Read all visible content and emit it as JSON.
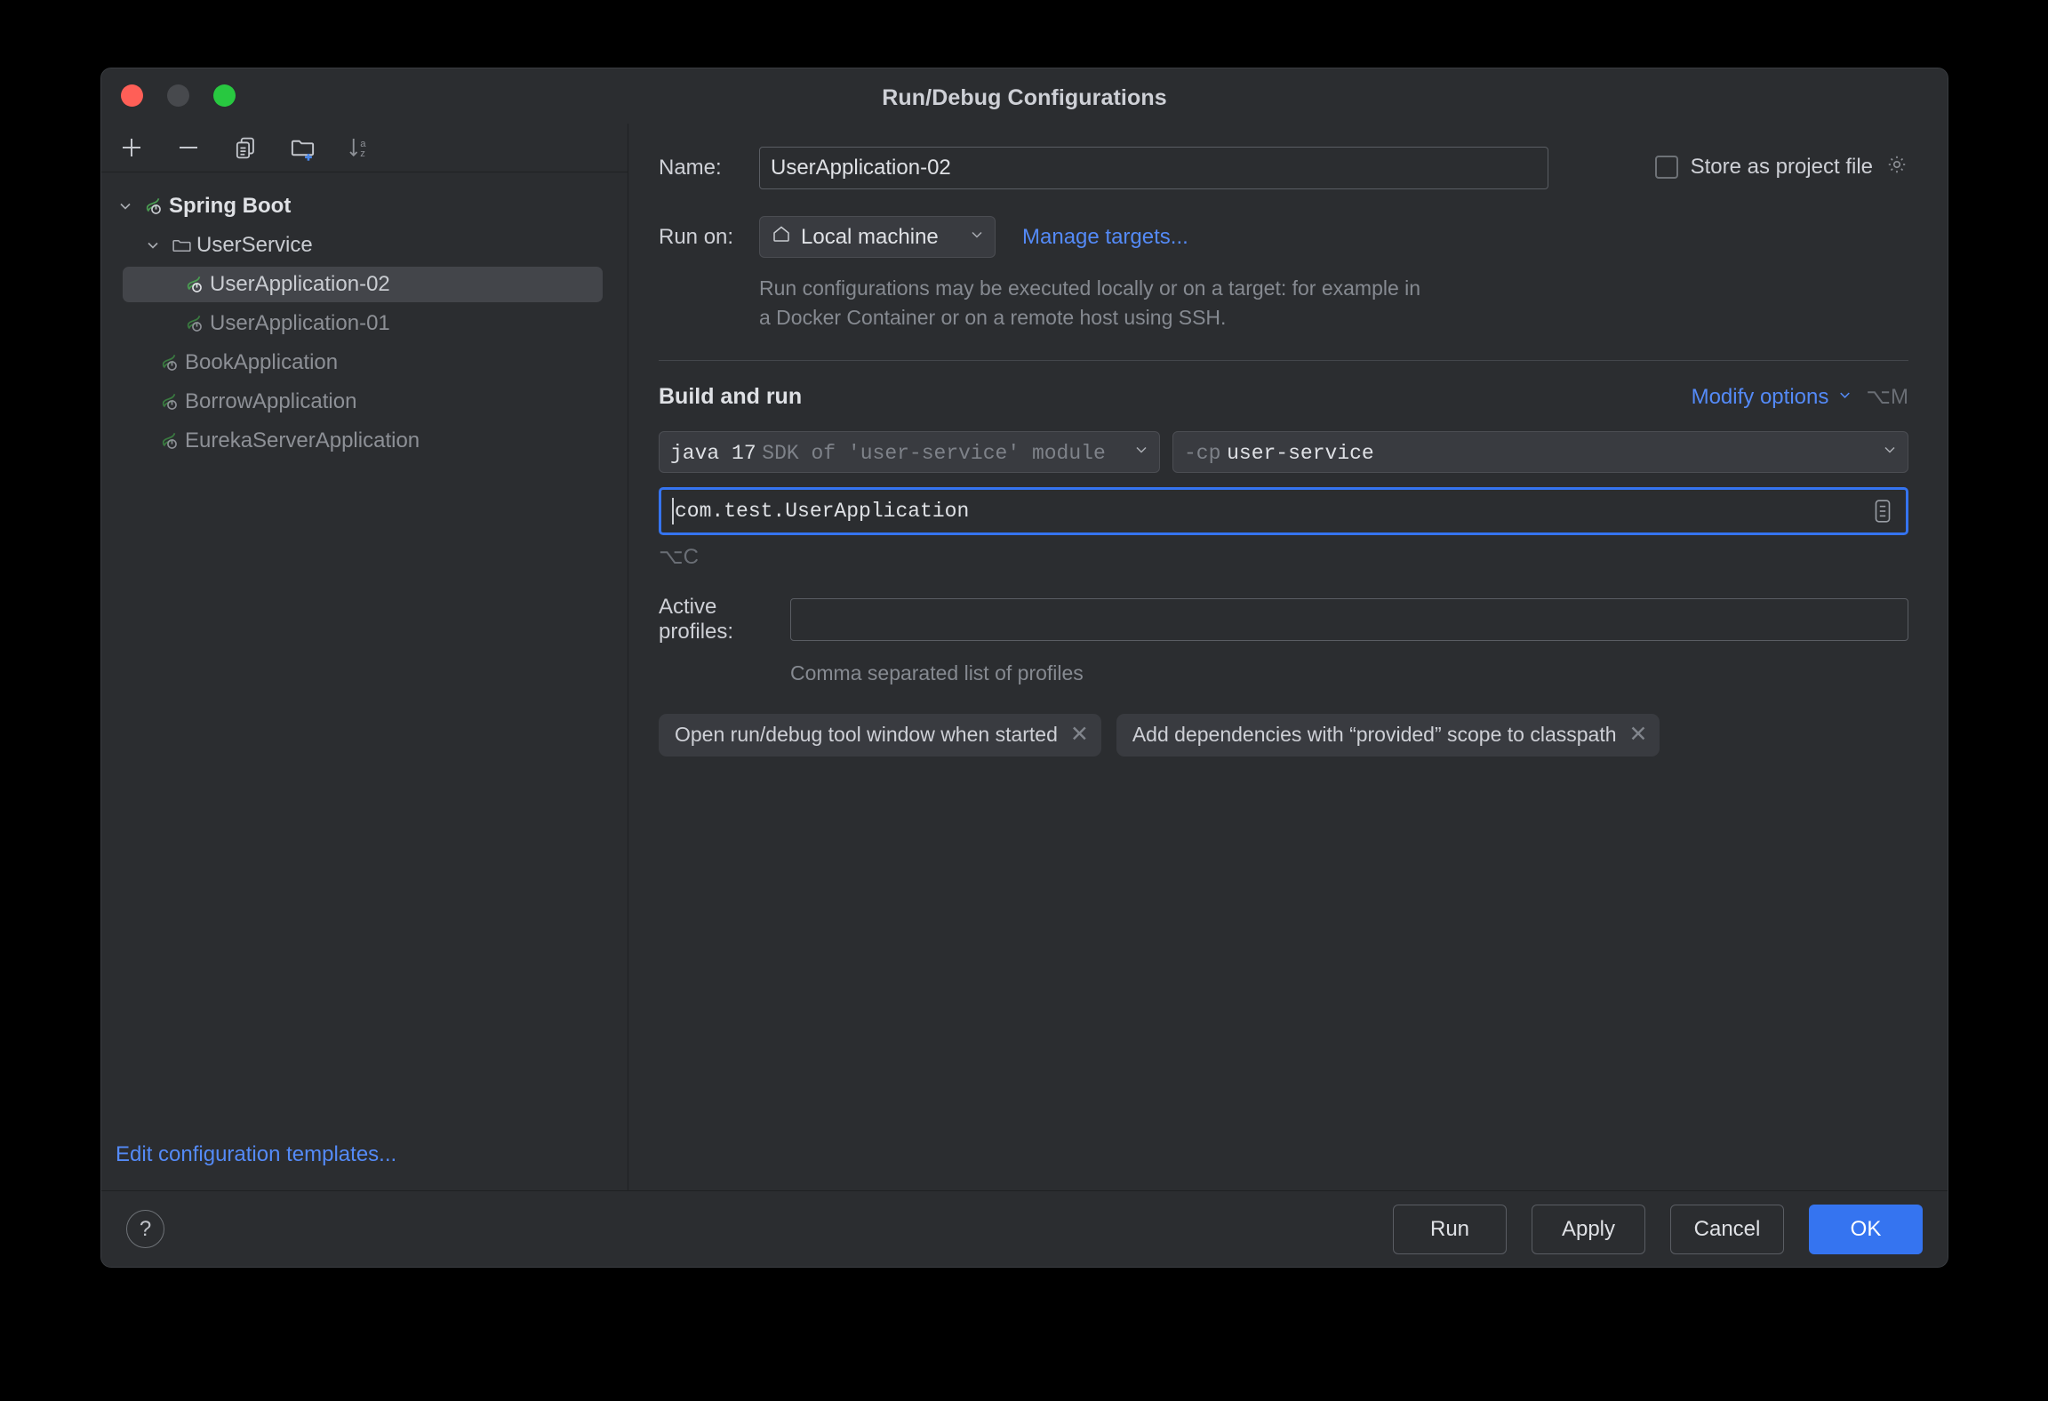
{
  "window": {
    "title": "Run/Debug Configurations",
    "traffic_lights": [
      "close",
      "minimize",
      "zoom"
    ]
  },
  "sidebar": {
    "toolbar": [
      {
        "name": "add-configuration-button",
        "icon": "plus-icon"
      },
      {
        "name": "remove-configuration-button",
        "icon": "minus-icon"
      },
      {
        "name": "copy-configuration-button",
        "icon": "copy-icon"
      },
      {
        "name": "new-folder-button",
        "icon": "folder-add-icon"
      },
      {
        "name": "sort-configurations-button",
        "icon": "sort-az-icon"
      }
    ],
    "tree": [
      {
        "label": "Spring Boot",
        "level": 0,
        "type": "group",
        "icon": "spring-boot-icon",
        "expanded": true,
        "selected": false,
        "dim": false
      },
      {
        "label": "UserService",
        "level": 1,
        "type": "folder",
        "icon": "folder-icon",
        "expanded": true,
        "selected": false,
        "dim": false
      },
      {
        "label": "UserApplication-02",
        "level": 2,
        "type": "config",
        "icon": "spring-boot-icon",
        "selected": true,
        "dim": false
      },
      {
        "label": "UserApplication-01",
        "level": 2,
        "type": "config",
        "icon": "spring-boot-icon",
        "selected": false,
        "dim": true
      },
      {
        "label": "BookApplication",
        "level": 1,
        "type": "config",
        "icon": "spring-boot-icon",
        "selected": false,
        "dim": true
      },
      {
        "label": "BorrowApplication",
        "level": 1,
        "type": "config",
        "icon": "spring-boot-icon",
        "selected": false,
        "dim": true
      },
      {
        "label": "EurekaServerApplication",
        "level": 1,
        "type": "config",
        "icon": "spring-boot-icon",
        "selected": false,
        "dim": true
      }
    ],
    "edit_templates_link": "Edit configuration templates..."
  },
  "form": {
    "name_label": "Name:",
    "name_value": "UserApplication-02",
    "name_placeholder": "",
    "store_as_project_file_label": "Store as project file",
    "store_as_project_file_checked": false,
    "store_settings_icon": "gear-icon",
    "run_on_label": "Run on:",
    "run_on_value": "Local machine",
    "run_on_icon": "home-icon",
    "manage_targets_link": "Manage targets...",
    "run_on_hint": "Run configurations may be executed locally or on a target: for example in a Docker Container or on a remote host using SSH.",
    "build_and_run_title": "Build and run",
    "modify_options_link": "Modify options",
    "modify_options_shortcut": "⌥M",
    "jdk_value_bright": "java 17",
    "jdk_value_dim": "SDK of 'user-service' module",
    "classpath_value_dim": "-cp",
    "classpath_value_bright": "user-service",
    "main_class_value": "com.test.UserApplication",
    "main_class_browse_icon": "document-list-icon",
    "main_class_shortcut": "⌥C",
    "active_profiles_label": "Active profiles:",
    "active_profiles_value": "",
    "active_profiles_placeholder": "",
    "active_profiles_hint": "Comma separated list of profiles",
    "chips": [
      {
        "label": "Open run/debug tool window when started",
        "remove_icon": "close-icon"
      },
      {
        "label": "Add dependencies with “provided” scope to classpath",
        "remove_icon": "close-icon"
      }
    ]
  },
  "footer": {
    "help_label": "?",
    "buttons": [
      {
        "label": "Run",
        "primary": false
      },
      {
        "label": "Apply",
        "primary": false
      },
      {
        "label": "Cancel",
        "primary": false
      },
      {
        "label": "OK",
        "primary": true
      }
    ]
  },
  "colors": {
    "accent_blue": "#3574F0",
    "link_blue": "#548AF7",
    "window_bg": "#2B2D30",
    "control_bg": "#393B40",
    "selection_bg": "#43454A",
    "spring_green": "#4A9C52",
    "traffic_close": "#FF5F57",
    "traffic_min": "#47494D",
    "traffic_max": "#28C840"
  }
}
